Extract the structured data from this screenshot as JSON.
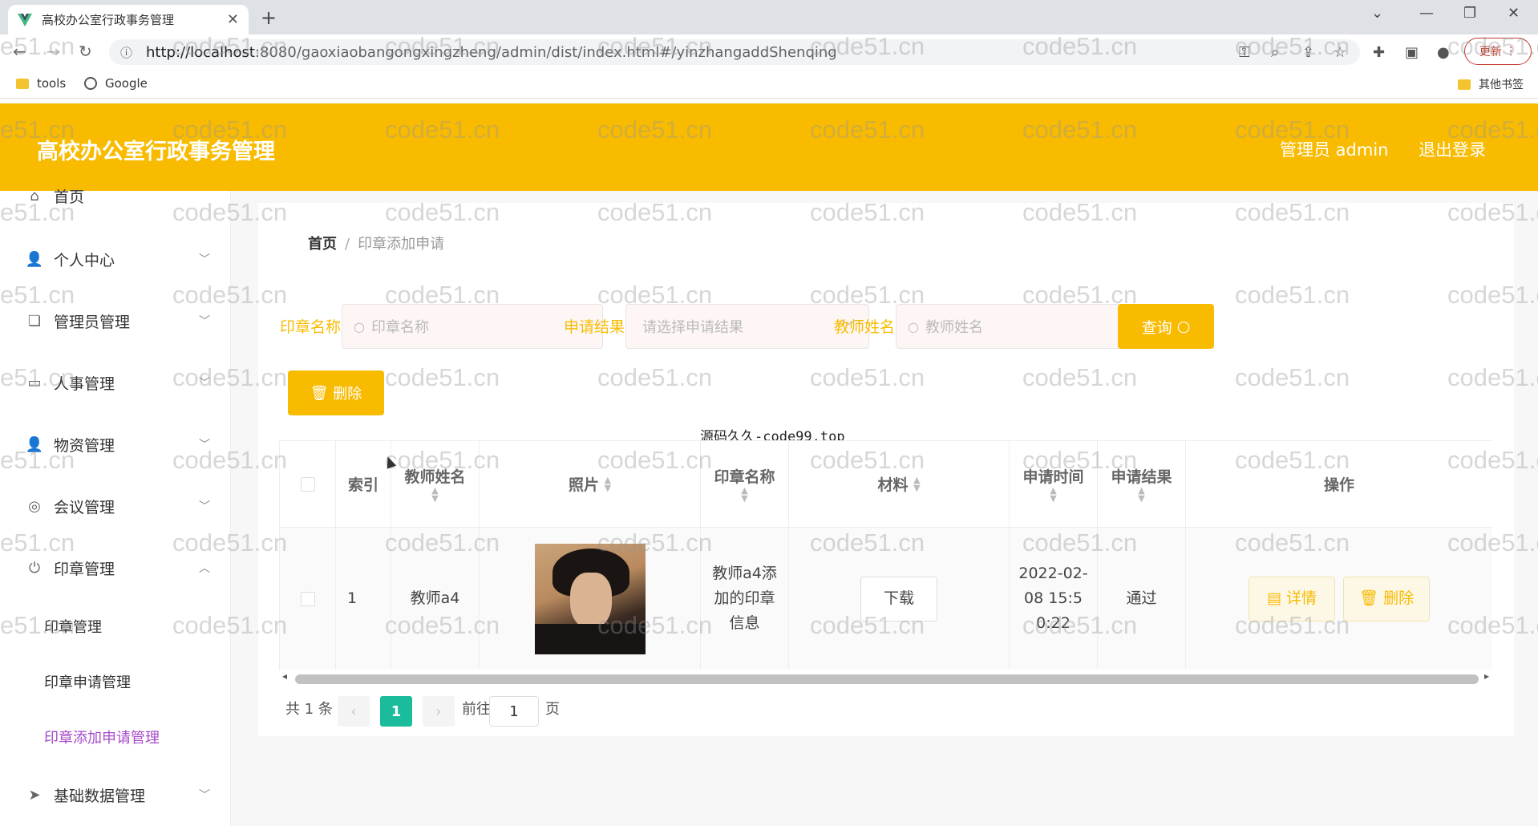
{
  "browser": {
    "tab_title": "高校办公室行政事务管理",
    "url_host": "http://localhost",
    "url_path": ":8080/gaoxiaobangongxingzheng/admin/dist/index.html#/yinzhangaddShenqing",
    "update_label": "更新",
    "bookmarks": [
      "tools",
      "Google"
    ],
    "other_bookmarks": "其他书签"
  },
  "header": {
    "title": "高校办公室行政事务管理",
    "user": "管理员 admin",
    "logout": "退出登录",
    "color": "#f8bb00"
  },
  "sidebar": {
    "items": [
      {
        "label": "首页",
        "icon": "home-icon"
      },
      {
        "label": "个人中心",
        "icon": "user-icon"
      },
      {
        "label": "管理员管理",
        "icon": "copy-icon"
      },
      {
        "label": "人事管理",
        "icon": "chat-icon"
      },
      {
        "label": "物资管理",
        "icon": "user-icon"
      },
      {
        "label": "会议管理",
        "icon": "compass-icon"
      },
      {
        "label": "印章管理",
        "icon": "power-icon"
      },
      {
        "label": "基础数据管理",
        "icon": "send-icon"
      }
    ],
    "sub_items": [
      "印章管理",
      "印章申请管理",
      "印章添加申请管理"
    ]
  },
  "breadcrumb": {
    "home": "首页",
    "separator": "/",
    "current": "印章添加申请"
  },
  "filters": {
    "seal_label": "印章名称",
    "seal_placeholder": "印章名称",
    "result_label": "申请结果",
    "result_placeholder": "请选择申请结果",
    "teacher_label": "教师姓名",
    "teacher_placeholder": "教师姓名",
    "query_label": "查询"
  },
  "delete_label": "删除",
  "source_watermark": "源码久久-code99.top",
  "table": {
    "headers": [
      "索引",
      "教师姓名",
      "照片",
      "印章名称",
      "材料",
      "申请时间",
      "申请结果",
      "操作"
    ],
    "rows": [
      {
        "index": "1",
        "teacher": "教师a4",
        "seal_name": "教师a4添加的印章信息",
        "material": "下载",
        "time": "2022-02-08 15:50:22",
        "result": "通过",
        "detail": "详情",
        "delete": "删除"
      }
    ]
  },
  "pagination": {
    "total": "共 1 条",
    "page": "1",
    "goto": "前往",
    "goto_value": "1",
    "page_unit": "页"
  },
  "watermark": "code51.cn"
}
